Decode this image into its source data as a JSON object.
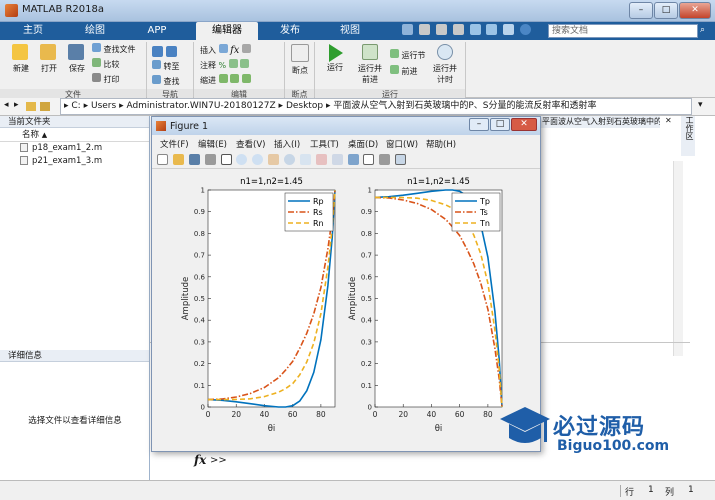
{
  "window": {
    "title": "MATLAB R2018a",
    "search_placeholder": "搜索文档"
  },
  "tabs": [
    "主页",
    "绘图",
    "APP",
    "编辑器",
    "发布",
    "视图"
  ],
  "ribbon": {
    "new": "新建",
    "open": "打开",
    "save": "保存",
    "find_files": "查找文件",
    "compare": "比较",
    "print": "打印",
    "goto": "转至",
    "find": "查找",
    "insert": "插入",
    "comment": "注释",
    "indent": "缩进",
    "breakpoints": "断点",
    "run": "运行",
    "run_advance": "运行并\n前进",
    "run_section": "运行节",
    "advance": "前进",
    "run_time": "运行并\n计时",
    "groups": [
      "文件",
      "导航",
      "编辑",
      "断点",
      "运行"
    ]
  },
  "address": {
    "parts": [
      "C:",
      "Users",
      "Administrator.WIN7U-20180127Z",
      "Desktop",
      "平面波从空气入射到石英玻璃中的P、S分量的能流反射率和透射率"
    ]
  },
  "left_panel": {
    "header": "当前文件夹",
    "col_name": "名称",
    "files": [
      "p18_exam1_2.m",
      "p21_exam1_3.m"
    ],
    "details_header": "详细信息",
    "details_text": "选择文件以查看详细信息"
  },
  "right_header": "平面波从空气入射到石英玻璃中的P、S分量的能流反射率和透射率...",
  "right_side_label": "工作区",
  "figure": {
    "title": "Figure 1",
    "menu": [
      "文件(F)",
      "编辑(E)",
      "查看(V)",
      "插入(I)",
      "工具(T)",
      "桌面(D)",
      "窗口(W)",
      "帮助(H)"
    ]
  },
  "command": {
    "prompt": ">>"
  },
  "status": {
    "row_label": "行",
    "row": "1",
    "col_label": "列",
    "col": "1"
  },
  "watermark": {
    "main": "必过源码",
    "sub": "Biguo100.com"
  },
  "chart_data": [
    {
      "type": "line",
      "title": "n1=1,n2=1.45",
      "xlabel": "θi",
      "ylabel": "Amplitude",
      "xlim": [
        0,
        90
      ],
      "ylim": [
        0,
        1
      ],
      "xticks": [
        0,
        20,
        40,
        60,
        80
      ],
      "yticks": [
        0,
        0.1,
        0.2,
        0.3,
        0.4,
        0.5,
        0.6,
        0.7,
        0.8,
        0.9,
        1
      ],
      "legend": "top-right",
      "series": [
        {
          "name": "Rp",
          "color": "#0072bd",
          "style": "solid",
          "x": [
            0,
            10,
            20,
            30,
            40,
            50,
            55,
            60,
            65,
            70,
            75,
            80,
            85,
            88,
            90
          ],
          "y": [
            0.034,
            0.031,
            0.024,
            0.015,
            0.006,
            0.0,
            0.0,
            0.006,
            0.027,
            0.075,
            0.16,
            0.31,
            0.56,
            0.78,
            1.0
          ]
        },
        {
          "name": "Rs",
          "color": "#d95319",
          "style": "dashdot",
          "x": [
            0,
            10,
            20,
            30,
            40,
            50,
            55,
            60,
            65,
            70,
            75,
            80,
            85,
            88,
            90
          ],
          "y": [
            0.034,
            0.037,
            0.046,
            0.062,
            0.09,
            0.135,
            0.17,
            0.21,
            0.27,
            0.34,
            0.43,
            0.55,
            0.73,
            0.87,
            1.0
          ]
        },
        {
          "name": "Rn",
          "color": "#edb120",
          "style": "dashed",
          "x": [
            0,
            10,
            20,
            30,
            40,
            50,
            55,
            60,
            65,
            70,
            75,
            80,
            85,
            88,
            90
          ],
          "y": [
            0.034,
            0.034,
            0.035,
            0.038,
            0.048,
            0.068,
            0.085,
            0.108,
            0.148,
            0.208,
            0.295,
            0.43,
            0.645,
            0.825,
            1.0
          ]
        }
      ]
    },
    {
      "type": "line",
      "title": "n1=1,n2=1.45",
      "xlabel": "θi",
      "ylabel": "Amplitude",
      "xlim": [
        0,
        90
      ],
      "ylim": [
        0,
        1
      ],
      "xticks": [
        0,
        20,
        40,
        60,
        80
      ],
      "yticks": [
        0,
        0.1,
        0.2,
        0.3,
        0.4,
        0.5,
        0.6,
        0.7,
        0.8,
        0.9,
        1
      ],
      "legend": "top-right",
      "series": [
        {
          "name": "Tp",
          "color": "#0072bd",
          "style": "solid",
          "x": [
            0,
            10,
            20,
            30,
            40,
            50,
            55,
            60,
            65,
            70,
            75,
            80,
            85,
            88,
            90
          ],
          "y": [
            0.966,
            0.969,
            0.976,
            0.985,
            0.994,
            1.0,
            1.0,
            0.994,
            0.973,
            0.925,
            0.84,
            0.69,
            0.44,
            0.22,
            0.0
          ]
        },
        {
          "name": "Ts",
          "color": "#d95319",
          "style": "dashdot",
          "x": [
            0,
            10,
            20,
            30,
            40,
            50,
            55,
            60,
            65,
            70,
            75,
            80,
            85,
            88,
            90
          ],
          "y": [
            0.966,
            0.963,
            0.954,
            0.938,
            0.91,
            0.865,
            0.83,
            0.79,
            0.73,
            0.66,
            0.57,
            0.45,
            0.27,
            0.13,
            0.0
          ]
        },
        {
          "name": "Tn",
          "color": "#edb120",
          "style": "dashed",
          "x": [
            0,
            10,
            20,
            30,
            40,
            50,
            55,
            60,
            65,
            70,
            75,
            80,
            85,
            88,
            90
          ],
          "y": [
            0.966,
            0.966,
            0.965,
            0.962,
            0.952,
            0.932,
            0.915,
            0.892,
            0.852,
            0.792,
            0.705,
            0.57,
            0.355,
            0.175,
            0.0
          ]
        }
      ]
    }
  ]
}
